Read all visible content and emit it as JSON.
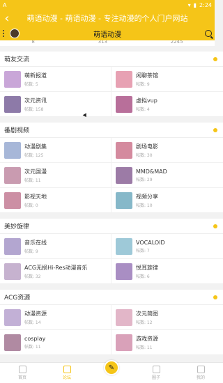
{
  "status_bar": {
    "time": "2:24",
    "left_text": "A"
  },
  "titlebar": {
    "title": "萌语动漫 - 萌语动漫 - 专注动漫的个人门户网站"
  },
  "appbar": {
    "title": "萌语动漫"
  },
  "stats": [
    "8",
    "313",
    "2245"
  ],
  "sections": [
    {
      "title": "萌友交流",
      "items": [
        {
          "name": "萌新报道",
          "count": "帖数: 5",
          "color": "#c9a6d8"
        },
        {
          "name": "闲聊茶馆",
          "count": "帖数: 9",
          "color": "#e7a1b3"
        },
        {
          "name": "次元资讯",
          "count": "帖数: 158",
          "color": "#8d7aa8"
        },
        {
          "name": "虚拟vup",
          "count": "帖数: 4",
          "color": "#b86f9a"
        }
      ]
    },
    {
      "title": "番剧视频",
      "items": [
        {
          "name": "动漫剧集",
          "count": "帖数: 125",
          "color": "#a7b7d8"
        },
        {
          "name": "剧场电影",
          "count": "帖数: 30",
          "color": "#d48a9e"
        },
        {
          "name": "次元国漫",
          "count": "帖数: 11",
          "color": "#c99bb0"
        },
        {
          "name": "MMD&MAD",
          "count": "帖数: 29",
          "color": "#9c7ba6"
        },
        {
          "name": "影视天地",
          "count": "帖数: 0",
          "color": "#cc8fa4"
        },
        {
          "name": "视频分享",
          "count": "帖数: 10",
          "color": "#86b8c9"
        }
      ]
    },
    {
      "title": "美妙旋律",
      "items": [
        {
          "name": "音乐在线",
          "count": "帖数: 9",
          "color": "#b3a6d0"
        },
        {
          "name": "VOCALOID",
          "count": "帖数: 7",
          "color": "#9ec9d8"
        },
        {
          "name": "ACG无损Hi-Res动漫音乐",
          "count": "帖数: 32",
          "color": "#c6b2cf"
        },
        {
          "name": "悦耳旋律",
          "count": "帖数: 6",
          "color": "#a98ec3"
        }
      ]
    },
    {
      "title": "ACG资源",
      "items": [
        {
          "name": "动漫资源",
          "count": "帖数: 14",
          "color": "#c2b0d6"
        },
        {
          "name": "次元简图",
          "count": "帖数: 12",
          "color": "#e2b6c8"
        },
        {
          "name": "cosplay",
          "count": "帖数: 11",
          "color": "#b08aa2"
        },
        {
          "name": "游戏资源",
          "count": "帖数: 11",
          "color": "#d9a1b9"
        }
      ]
    }
  ],
  "bottom_nav": [
    {
      "label": "首页",
      "active": false
    },
    {
      "label": "论坛",
      "active": true
    },
    {
      "label": "",
      "center": true
    },
    {
      "label": "圈子",
      "active": false
    },
    {
      "label": "我的",
      "active": false
    }
  ],
  "colors": {
    "accent": "#f5c518"
  }
}
